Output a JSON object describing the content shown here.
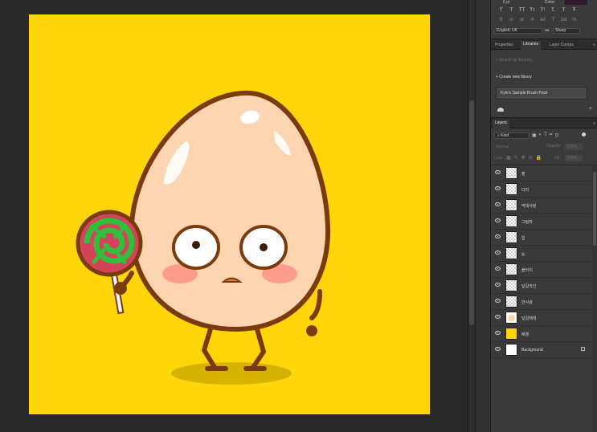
{
  "character": {
    "font_size": "6 pt",
    "color_label": "Color:",
    "color_swatch": "#3b1530",
    "glyph_row_1": [
      "T",
      "T",
      "TT",
      "Tт",
      "T¹",
      "T,",
      "T",
      "Ŧ"
    ],
    "glyph_row_2": [
      "fi",
      "ơ",
      "st",
      "A",
      "ad",
      "T",
      "1st",
      "½"
    ],
    "language": "English: UK",
    "aa_icon": "aa",
    "antialias": "Sharp"
  },
  "library_tabs": {
    "items": [
      "Properties",
      "Libraries",
      "Layer Comps"
    ],
    "active": "Libraries",
    "menu": "≡"
  },
  "libraries": {
    "search_placeholder": "Search all libraries",
    "create_label": "+ Create new library",
    "items": [
      "Kyle's Sample Brush Pack"
    ],
    "add_icon": "+"
  },
  "layer_tabs": {
    "items": [
      "Layers"
    ],
    "menu": "≡"
  },
  "layer_tools": {
    "kind": "Kind",
    "filter_icons": [
      "▣",
      "◐",
      "T",
      "⌗",
      "⊡"
    ],
    "blend_mode": "Normal",
    "opacity_label": "Opacity:",
    "opacity_value": "100%",
    "lock_label": "Lock:",
    "lock_icons": [
      "▦",
      "✎",
      "✥",
      "⊟",
      "🔒"
    ],
    "fill_label": "Fill:",
    "fill_value": "100%"
  },
  "layers": [
    {
      "name": "팔",
      "thumb": "transparent"
    },
    {
      "name": "다리",
      "thumb": "transparent"
    },
    {
      "name": "막대사탕",
      "thumb": "transparent"
    },
    {
      "name": "그림자",
      "thumb": "transparent"
    },
    {
      "name": "입",
      "thumb": "transparent"
    },
    {
      "name": "눈",
      "thumb": "transparent"
    },
    {
      "name": "볼터치",
      "thumb": "transparent"
    },
    {
      "name": "달걀라인",
      "thumb": "transparent"
    },
    {
      "name": "반사광",
      "thumb": "transparent"
    },
    {
      "name": "달걀채색",
      "thumb": "egg"
    },
    {
      "name": "배경",
      "thumb": "#ffd60a"
    },
    {
      "name": "Background",
      "thumb": "#ffffff",
      "locked": true
    }
  ],
  "colors": {
    "canvas_bg": "#ffd60a",
    "egg": "#fdd5b1",
    "outline": "#7a3a0a"
  }
}
